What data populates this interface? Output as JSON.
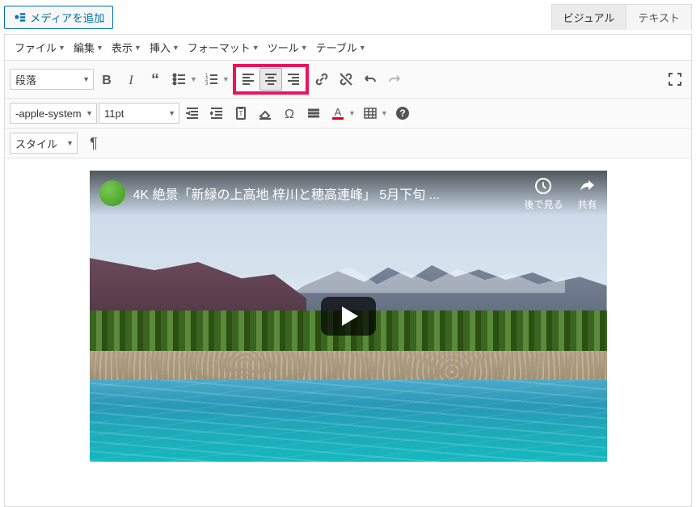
{
  "topbar": {
    "media_button": "メディアを追加",
    "tabs": {
      "visual": "ビジュアル",
      "text": "テキスト"
    }
  },
  "menubar": {
    "file": "ファイル",
    "edit": "編集",
    "view": "表示",
    "insert": "挿入",
    "format": "フォーマット",
    "tools": "ツール",
    "table": "テーブル"
  },
  "toolbar": {
    "paragraph_select": "段落",
    "font_family_select": "-apple-system",
    "font_size_select": "11pt",
    "style_select": "スタイル"
  },
  "video": {
    "title": "4K 絶景「新緑の上高地 梓川と穂高連峰」 5月下旬 ...",
    "watch_later": "後で見る",
    "share": "共有"
  }
}
